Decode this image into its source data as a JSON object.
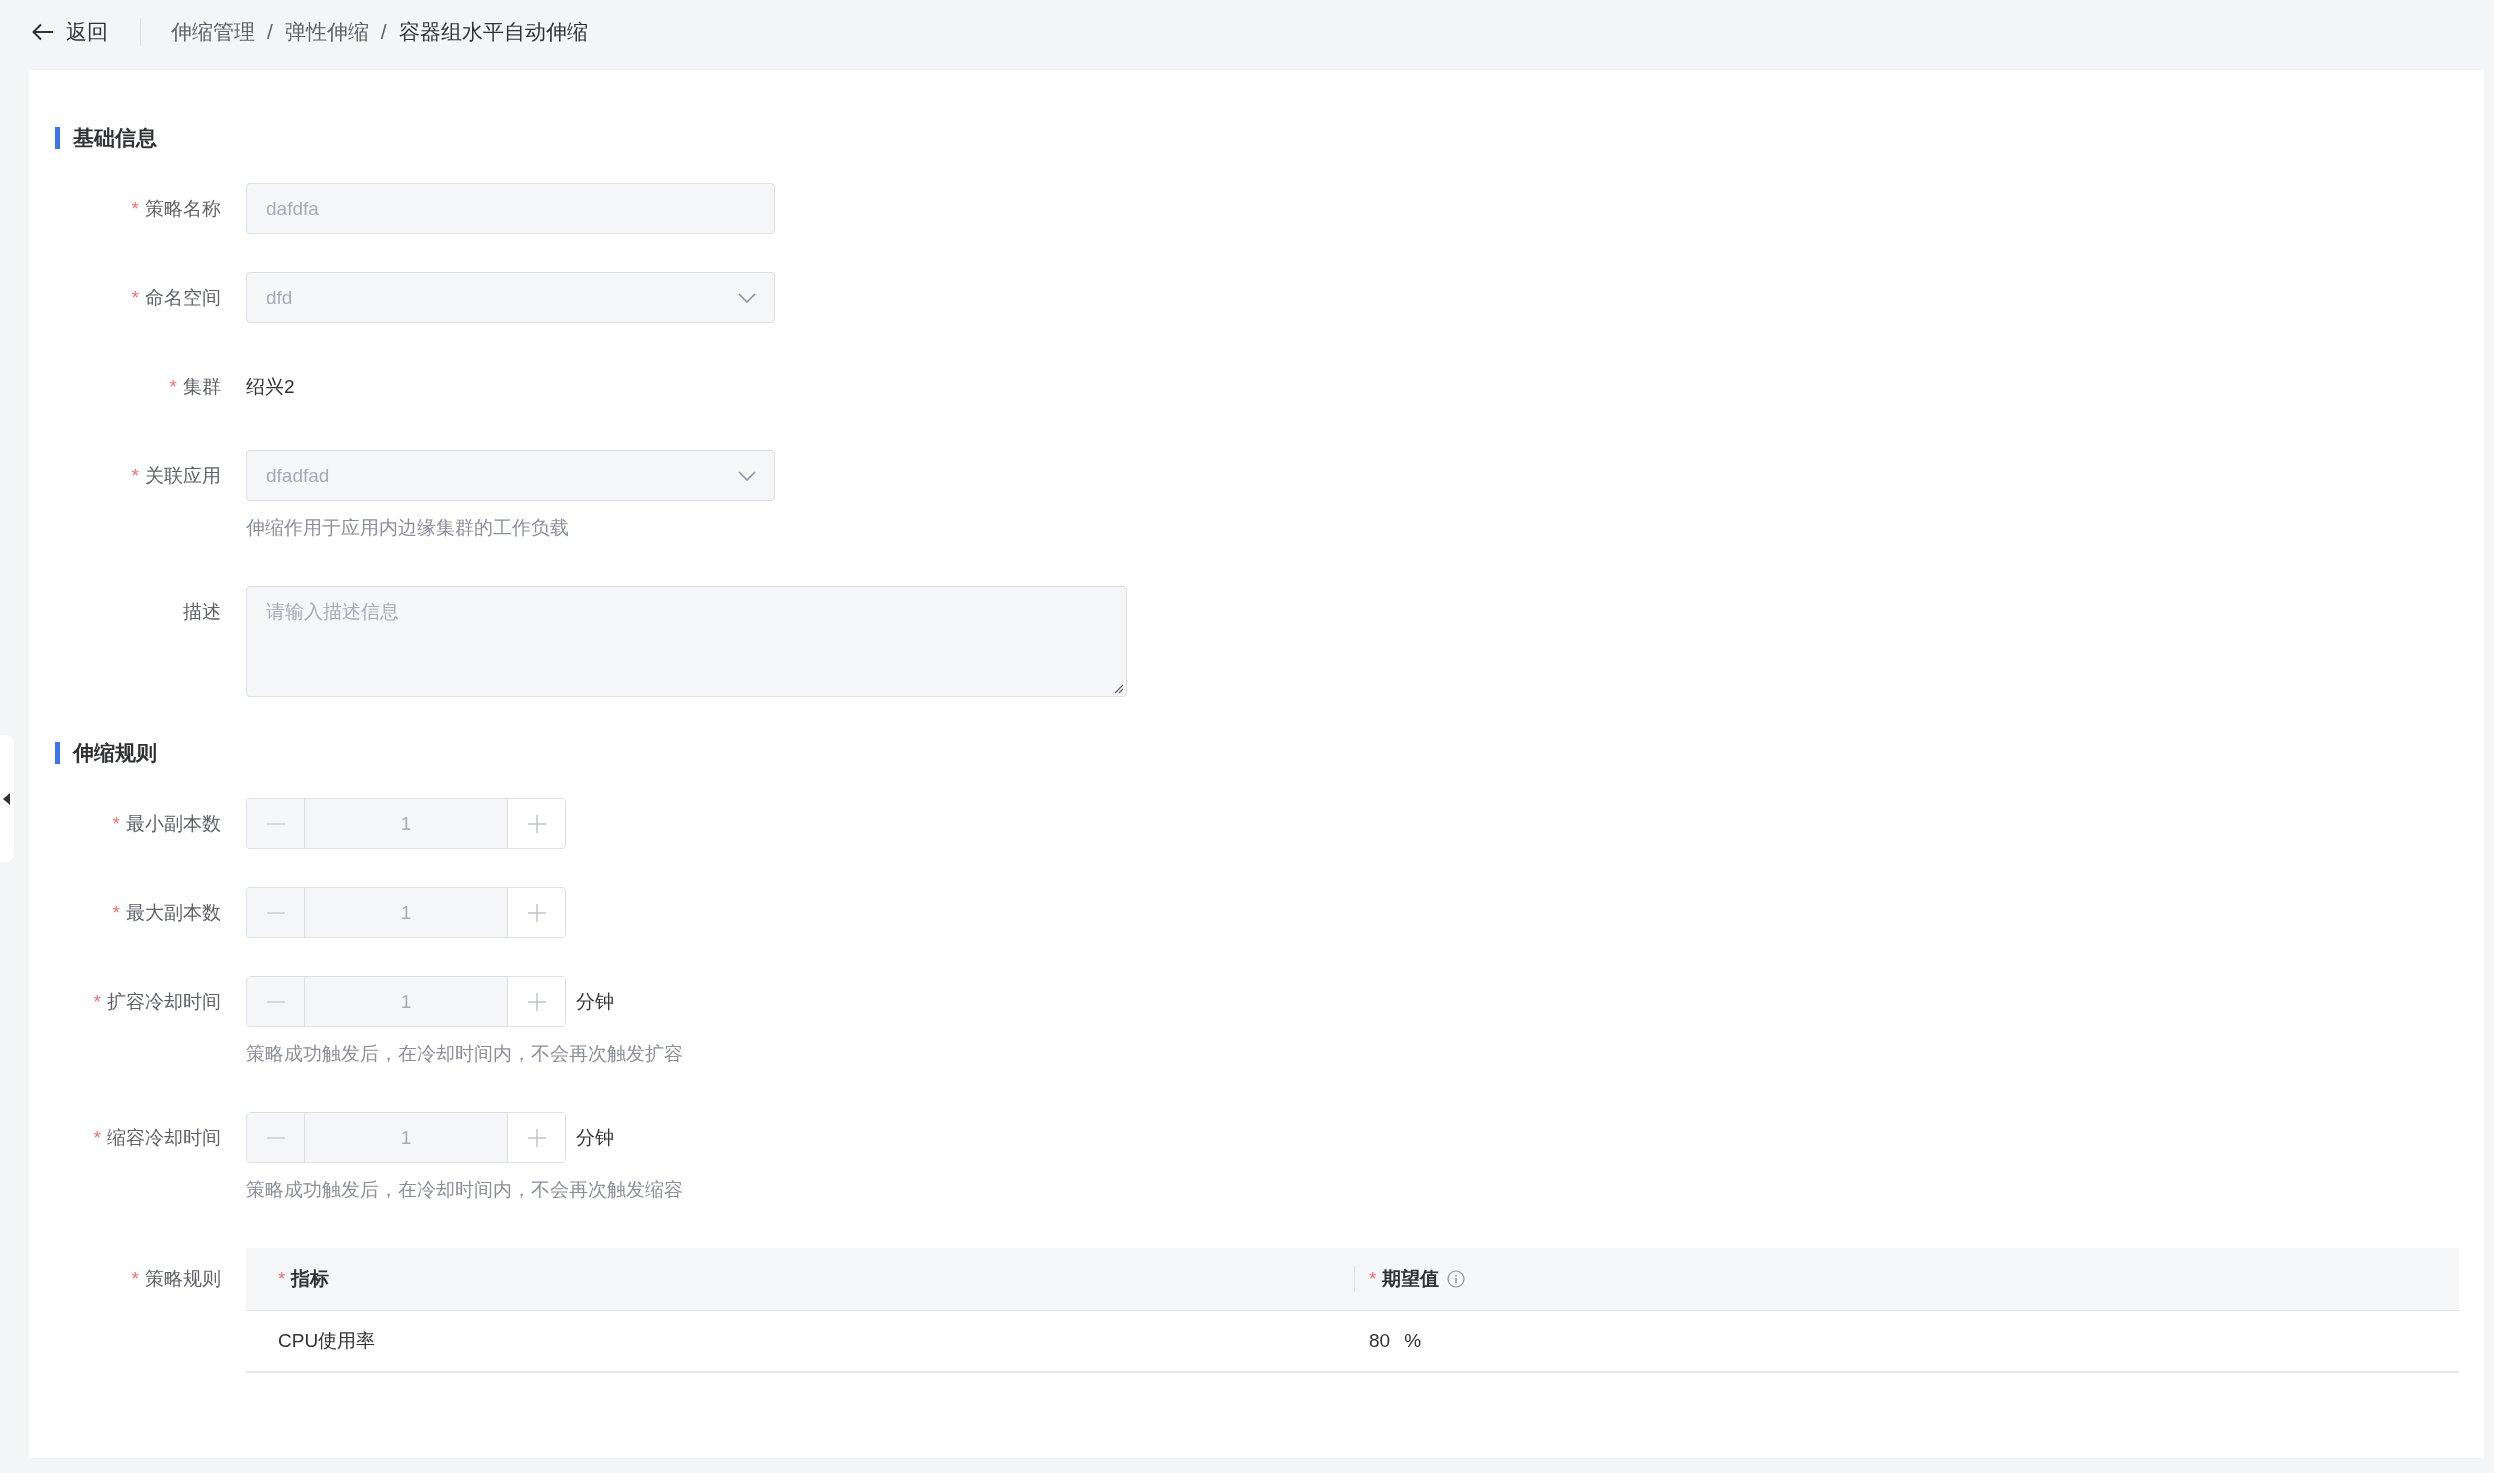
{
  "top_bar": {
    "back": {
      "label": "返回"
    },
    "separator": "/",
    "breadcrumbs": [
      {
        "label": "伸缩管理",
        "current": false
      },
      {
        "label": "弹性伸缩",
        "current": false
      },
      {
        "label": "容器组水平自动伸缩",
        "current": true
      }
    ]
  },
  "sections": [
    {
      "title": "基础信息",
      "fields": [
        {
          "kind": "text",
          "label": "策略名称",
          "required_mark": "*",
          "disabled": true,
          "value": "dafdfa"
        },
        {
          "kind": "select",
          "label": "命名空间",
          "required_mark": "*",
          "disabled": true,
          "value": "dfd"
        },
        {
          "kind": "static",
          "label": "集群",
          "required_mark": "*",
          "value": "绍兴2"
        },
        {
          "kind": "select",
          "label": "关联应用",
          "required_mark": "*",
          "disabled": true,
          "value": "dfadfad",
          "hint": "伸缩作用于应用内边缘集群的工作负载"
        },
        {
          "kind": "textarea",
          "label": "描述",
          "placeholder": "请输入描述信息"
        }
      ]
    },
    {
      "title": "伸缩规则",
      "fields": [
        {
          "kind": "number",
          "label": "最小副本数",
          "required_mark": "*",
          "disabled": true,
          "value": "1"
        },
        {
          "kind": "number",
          "label": "最大副本数",
          "required_mark": "*",
          "disabled": true,
          "value": "1"
        },
        {
          "kind": "number",
          "label": "扩容冷却时间",
          "required_mark": "*",
          "disabled": true,
          "value": "1",
          "unit": "分钟",
          "hint": "策略成功触发后，在冷却时间内，不会再次触发扩容"
        },
        {
          "kind": "number",
          "label": "缩容冷却时间",
          "required_mark": "*",
          "disabled": true,
          "value": "1",
          "unit": "分钟",
          "hint": "策略成功触发后，在冷却时间内，不会再次触发缩容"
        },
        {
          "kind": "table",
          "label": "策略规则",
          "required_mark": "*",
          "columns": [
            {
              "label": "指标",
              "required_mark": "*"
            },
            {
              "label": "期望值",
              "required_mark": "*",
              "info": true
            }
          ],
          "rows": [
            {
              "metric": "CPU使用率",
              "value": "80",
              "unit": "%"
            }
          ]
        }
      ]
    }
  ]
}
